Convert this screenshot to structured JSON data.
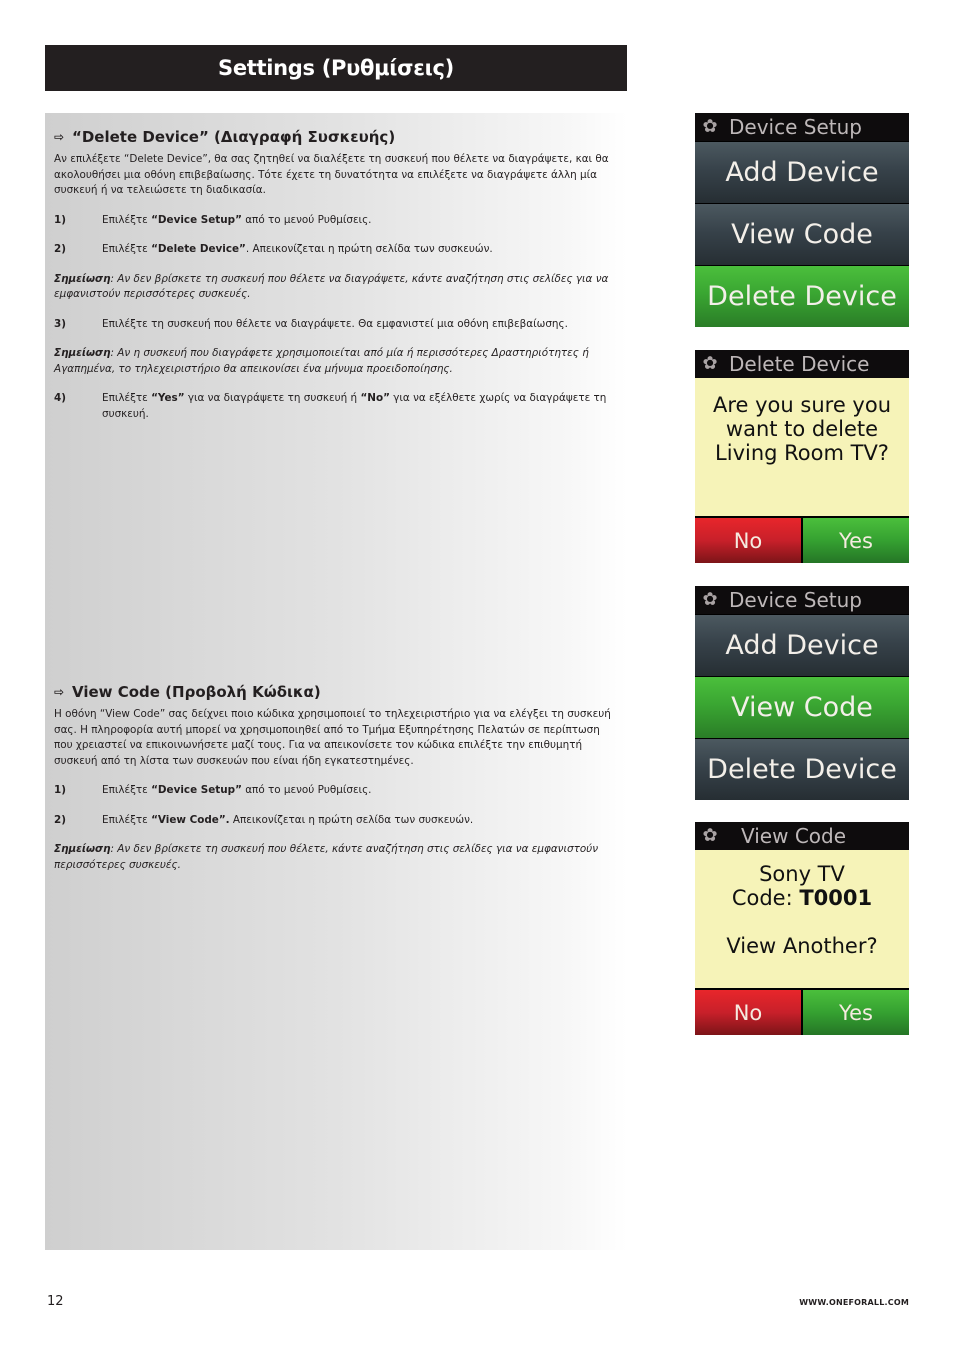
{
  "header": {
    "title": "Settings (Ρυθμίσεις)"
  },
  "delete_section": {
    "title": "“Delete Device” (Διαγραφή Συσκευής)",
    "intro": "Αν επιλέξετε “Delete Device”, θα σας ζητηθεί να διαλέξετε τη συσκευή που θέλετε να διαγράψετε, και θα ακολουθήσει μια οθόνη επιβεβαίωσης. Τότε έχετε τη δυνατότητα να επιλέξετε να διαγράψετε άλλη μία συσκευή ή να τελειώσετε τη διαδικασία.",
    "step1": {
      "num": "1)",
      "pre": "Επιλέξτε ",
      "bold": "“Device Setup”",
      "post": " από το μενού Ρυθμίσεις."
    },
    "step2": {
      "num": "2)",
      "pre": "Επιλέξτε ",
      "bold": "“Delete Device”",
      "post": ". Απεικονίζεται η πρώτη σελίδα των συσκευών."
    },
    "note1": {
      "label": "Σημείωση",
      "text": ": Αν δεν βρίσκετε τη συσκευή που θέλετε να διαγράψετε, κάντε αναζήτηση στις σελίδες για να εμφανιστούν περισσότερες συσκευές."
    },
    "step3": {
      "num": "3)",
      "text": "Επιλέξτε τη συσκευή που θέλετε να διαγράψετε. Θα εμφανιστεί μια οθόνη επιβεβαίωσης."
    },
    "note2": {
      "label": "Σημείωση",
      "text": ": Αν η συσκευή που διαγράφετε χρησιμοποιείται από μία ή περισσότερες Δραστηριότητες ή Αγαπημένα, το τηλεχειριστήριο θα απεικονίσει ένα μήνυμα προειδοποίησης."
    },
    "step4": {
      "num": "4)",
      "pre": "Επιλέξτε ",
      "bold1": "“Yes”",
      "mid": " για να διαγράψετε τη συσκευή ή ",
      "bold2": "“No”",
      "post": " για να εξέλθετε χωρίς να διαγράψετε τη συσκευή."
    }
  },
  "view_section": {
    "title": "View Code (Προβολή Κώδικα)",
    "intro": "Η οθόνη “View Code” σας δείχνει ποιο κώδικα χρησιμοποιεί το τηλεχειριστήριο για να ελέγξει τη συσκευή σας. Η πληροφορία αυτή μπορεί να χρησιμοποιηθεί από το Τμήμα Εξυπηρέτησης Πελατών σε περίπτωση που χρειαστεί να επικοινωνήσετε μαζί τους. Για να απεικονίσετε τον κώδικα επιλέξτε την επιθυμητή συσκευή από τη λίστα των συσκευών που είναι ήδη εγκατεστημένες.",
    "step1": {
      "num": "1)",
      "pre": "Επιλέξτε ",
      "bold": "“Device Setup”",
      "post": " από το μενού Ρυθμίσεις."
    },
    "step2": {
      "num": "2)",
      "pre": "Επιλέξτε ",
      "bold": "“View Code”.",
      "post": " Απεικονίζεται η πρώτη σελίδα των συσκευών."
    },
    "note1": {
      "label": "Σημείωση",
      "text": ": Αν δεν βρίσκετε τη συσκευή που θέλετε, κάντε αναζήτηση στις σελίδες για να εμφανιστούν περισσότερες συσκευές."
    }
  },
  "screens": {
    "setup1": {
      "title": "Device Setup",
      "items": [
        "Add Device",
        "View Code",
        "Delete Device"
      ],
      "active": "Delete Device"
    },
    "confirm_delete": {
      "title": "Delete Device",
      "line1": "Are you sure you",
      "line2": "want to delete",
      "line3": "Living Room TV?",
      "no": "No",
      "yes": "Yes"
    },
    "setup2": {
      "title": "Device Setup",
      "items": [
        "Add Device",
        "View Code",
        "Delete Device"
      ],
      "active": "View Code"
    },
    "view_code": {
      "title": "View Code",
      "device": "Sony TV",
      "code_label": "Code: ",
      "code_value": "T0001",
      "prompt": "View Another?",
      "no": "No",
      "yes": "Yes"
    }
  },
  "footer": {
    "page_number": "12",
    "website": "WWW.ONEFORALL.COM"
  }
}
